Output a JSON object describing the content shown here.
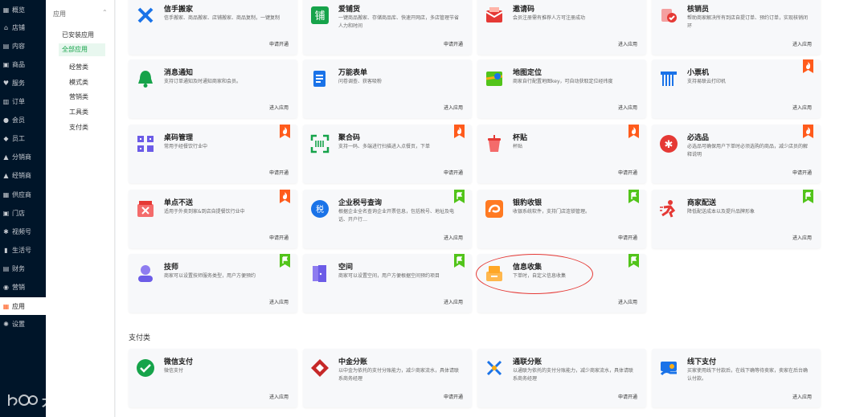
{
  "sidebar": {
    "items": [
      {
        "label": "概览",
        "icon": "overview-icon",
        "glyph": "▦"
      },
      {
        "label": "店铺",
        "icon": "store-icon",
        "glyph": "⌂"
      },
      {
        "label": "内容",
        "icon": "content-icon",
        "glyph": "▤"
      },
      {
        "label": "商品",
        "icon": "goods-icon",
        "glyph": "▣"
      },
      {
        "label": "服务",
        "icon": "service-icon",
        "glyph": "♥"
      },
      {
        "label": "订单",
        "icon": "order-icon",
        "glyph": "▥"
      },
      {
        "label": "会员",
        "icon": "member-icon",
        "glyph": "●"
      },
      {
        "label": "员工",
        "icon": "staff-icon",
        "glyph": "◆"
      },
      {
        "label": "分销商",
        "icon": "distributor-icon",
        "glyph": "▲"
      },
      {
        "label": "经销商",
        "icon": "dealer-icon",
        "glyph": "▲"
      },
      {
        "label": "供应商",
        "icon": "supplier-icon",
        "glyph": "▦"
      },
      {
        "label": "门店",
        "icon": "shop-icon",
        "glyph": "▣"
      },
      {
        "label": "视频号",
        "icon": "video-icon",
        "glyph": "✱"
      },
      {
        "label": "生活号",
        "icon": "life-icon",
        "glyph": "▮"
      },
      {
        "label": "财务",
        "icon": "finance-icon",
        "glyph": "▤"
      },
      {
        "label": "营销",
        "icon": "marketing-icon",
        "glyph": "◉"
      },
      {
        "label": "应用",
        "icon": "apps-icon",
        "glyph": "▦"
      },
      {
        "label": "设置",
        "icon": "settings-icon",
        "glyph": "✺"
      }
    ],
    "active_index": 16
  },
  "submenu": {
    "header": "应用",
    "items": [
      "已安装应用",
      "全部应用",
      "经营类",
      "模式类",
      "营销类",
      "工具类",
      "支付类"
    ]
  },
  "cards_row1": [
    {
      "title": "信手搬家",
      "desc": "信手搬家、商品搬家、店铺搬家、商品复制，一键复制",
      "action": "申请开通",
      "icon": "move-icon"
    },
    {
      "title": "爱铺货",
      "desc": "一键商品搬家、存储商品库、快速开网店，多店管理节省人力和时间",
      "action": "申请开通",
      "icon": "shop-goods-icon"
    },
    {
      "title": "邀请码",
      "desc": "会员注册需有推荐人方可注册成功",
      "action": "进入应用",
      "icon": "invite-code-icon"
    },
    {
      "title": "核销员",
      "desc": "帮助商家解决所有到店自提订单、预约订单，实现核销闭环",
      "action": "进入应用",
      "icon": "verify-icon"
    }
  ],
  "cards_row2": [
    {
      "title": "消息通知",
      "desc": "支持订单通知及时通知商家和会员。",
      "action": "进入应用",
      "icon": "bell-icon"
    },
    {
      "title": "万能表单",
      "desc": "问卷调查、获客吸粉",
      "action": "进入应用",
      "icon": "form-icon"
    },
    {
      "title": "地图定位",
      "desc": "商家自行配置地图key，可自动获取定位经纬度",
      "action": "进入应用",
      "icon": "map-icon"
    },
    {
      "title": "小票机",
      "desc": "支持易联云打印机",
      "action": "进入应用",
      "icon": "printer-icon",
      "badge": "hot"
    }
  ],
  "cards_row3": [
    {
      "title": "桌码管理",
      "desc": "常用于经餐饮行业中",
      "action": "申请开通",
      "icon": "table-code-icon",
      "badge": "hot"
    },
    {
      "title": "聚合码",
      "desc": "支持一码、多端进行扫描进入点餐页，下单",
      "action": "申请开通",
      "icon": "scan-icon",
      "badge": "hot"
    },
    {
      "title": "杯贴",
      "desc": "杯贴",
      "action": "申请开通",
      "icon": "cup-icon",
      "badge": "hot"
    },
    {
      "title": "必选品",
      "desc": "必选品可确保用户下单时必须选购的商品，减少店员的解释说明",
      "action": "申请开通",
      "icon": "required-icon",
      "badge": "hot"
    }
  ],
  "cards_row4": [
    {
      "title": "单点不送",
      "desc": "适用于外卖到家&到店自提餐饮行业中",
      "action": "申请开通",
      "icon": "no-delivery-icon",
      "badge": "hot"
    },
    {
      "title": "企业税号查询",
      "desc": "根据企业全名查询企业开票信息，包括税号、地址及电话、开户行…",
      "action": "进入应用",
      "icon": "tax-icon",
      "badge": "new"
    },
    {
      "title": "银豹收银",
      "desc": "收银系统软件，支持门店连锁管理。",
      "action": "申请开通",
      "icon": "cashier-icon",
      "badge": "new"
    },
    {
      "title": "商家配送",
      "desc": "降低配送成本以及提升品牌形象",
      "action": "进入应用",
      "icon": "delivery-icon",
      "badge": "new"
    }
  ],
  "cards_row5": [
    {
      "title": "技师",
      "desc": "商家可以设置技师服务类型，用户方便预约",
      "action": "进入应用",
      "icon": "technician-icon",
      "badge": "new"
    },
    {
      "title": "空间",
      "desc": "商家可以设置空间，用户方便根据空间预约项目",
      "action": "进入应用",
      "icon": "space-icon",
      "badge": "new"
    },
    {
      "title": "信息收集",
      "desc": "下单时，自定义信息收集",
      "action": "进入应用",
      "icon": "collect-icon",
      "badge": "new"
    }
  ],
  "payment_section": {
    "title": "支付类",
    "cards": [
      {
        "title": "微信支付",
        "desc": "微信支付",
        "action": "进入应用",
        "icon": "wechat-pay-icon"
      },
      {
        "title": "中金分账",
        "desc": "以中金为依托的支付分账能力，减少商家流水，具体请联系商务经理",
        "action": "申请开通",
        "icon": "cicc-icon"
      },
      {
        "title": "通联分账",
        "desc": "以通联为依托的支付分账能力，减少商家流水，具体请联系商务经理",
        "action": "申请开通",
        "icon": "allinpay-icon"
      },
      {
        "title": "线下支付",
        "desc": "买家使用线下付款后，在线下确等待卖家，卖家在后台确认付款。",
        "action": "进入应用",
        "icon": "offline-pay-icon"
      }
    ]
  },
  "watermark": {
    "text": "大数跨境"
  },
  "colors": {
    "accent": "#16a34a",
    "sidebar_bg": "#001529",
    "hot": "#ff5b1c",
    "new": "#52c41a",
    "highlight": "#e53935"
  }
}
